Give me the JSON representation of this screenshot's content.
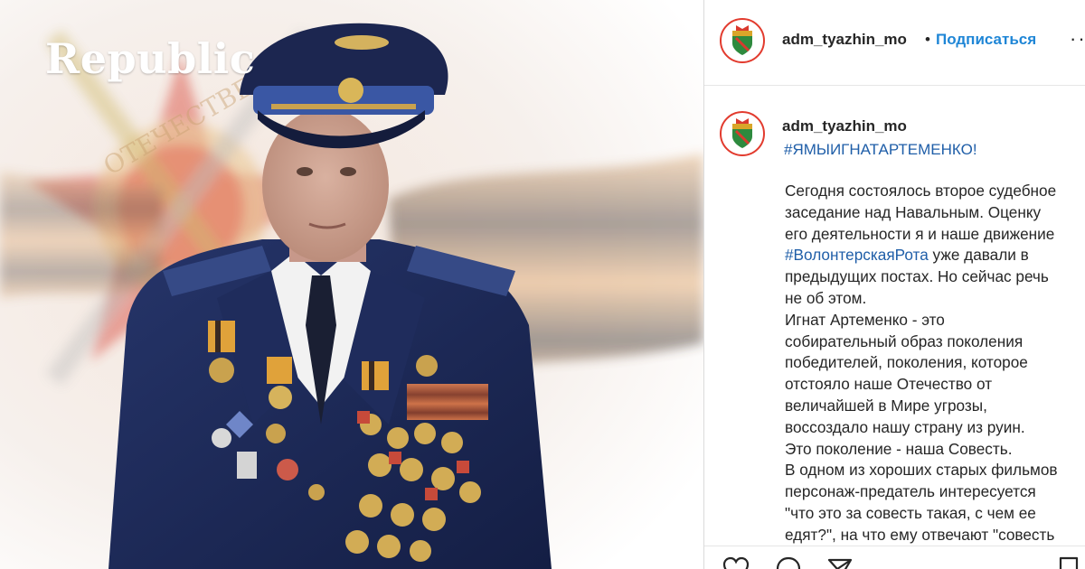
{
  "overlay": {
    "brand": "Republic"
  },
  "photo": {
    "medal_inscription": "ОТЕЧЕСТВЕННАЯ"
  },
  "instagram": {
    "header": {
      "username": "adm_tyazhin_mo",
      "separator": "•",
      "follow_label": "Подписаться",
      "more_label": "···"
    },
    "post": {
      "username": "adm_tyazhin_mo",
      "hashtag": "#ЯМЫИГНАТАРТЕМЕНКО!",
      "lines": {
        "l1": "Сегодня состоялось второе судебное",
        "l2": "заседание над Навальным. Оценку",
        "l3": "его деятельности я и наше движение",
        "l4_link": "#ВолонтерскаяРота",
        "l4_rest": " уже давали в",
        "l5": "предыдущих постах. Но сейчас речь",
        "l6": "не об этом.",
        "l7": "Игнат Артеменко - это",
        "l8": "собирательный образ поколения",
        "l9": "победителей, поколения, которое",
        "l10": "отстояло наше Отечество от",
        "l11": "величайшей в Мире угрозы,",
        "l12": "воссоздало нашу страну из руин.",
        "l13": "Это поколение - наша Совесть.",
        "l14": "В одном из хороших старых фильмов",
        "l15": "персонаж-предатель интересуется",
        "l16": "\"что это за совесть такая, с чем ее",
        "l17": "едят?\", на что ему отвечают \"совесть"
      }
    },
    "actions": [
      "heart-icon",
      "comment-icon",
      "share-icon",
      "bookmark-icon"
    ]
  },
  "colors": {
    "link": "#1f5ea8",
    "follow": "#1f86d6",
    "uniform": "#1d2a5a"
  }
}
